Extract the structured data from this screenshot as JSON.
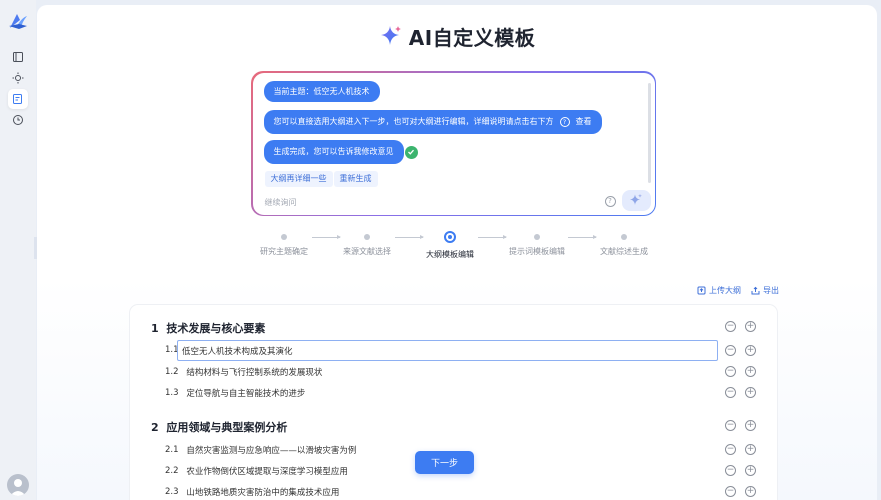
{
  "page": {
    "title": "AI自定义模板"
  },
  "chat": {
    "messages": [
      "当前主题：低空无人机技术",
      "您可以直接选用大纲进入下一步，也可对大纲进行编辑，详细说明请点击右下方",
      "生成完成，您可以告诉我修改意见"
    ],
    "help_badge": "?",
    "view_link": "查看",
    "chips": [
      "大纲再详细一些",
      "重新生成"
    ],
    "input_placeholder": "继续询问",
    "input_help": "?"
  },
  "steps": [
    {
      "label": "研究主题确定",
      "current": false
    },
    {
      "label": "来源文献选择",
      "current": false
    },
    {
      "label": "大纲模板编辑",
      "current": true
    },
    {
      "label": "提示词模板编辑",
      "current": false
    },
    {
      "label": "文献综述生成",
      "current": false
    }
  ],
  "actions": {
    "upload": "上传大纲",
    "export": "导出"
  },
  "outline": {
    "sections": [
      {
        "number": "1",
        "title": "技术发展与核心要素",
        "items": [
          {
            "number": "1.1",
            "text": "低空无人机技术构成及其演化"
          },
          {
            "number": "1.2",
            "text": "结构材料与飞行控制系统的发展现状"
          },
          {
            "number": "1.3",
            "text": "定位导航与自主智能技术的进步"
          }
        ]
      },
      {
        "number": "2",
        "title": "应用领域与典型案例分析",
        "items": [
          {
            "number": "2.1",
            "text": "自然灾害监测与应急响应——以滑坡灾害为例"
          },
          {
            "number": "2.2",
            "text": "农业作物倒伏区域提取与深度学习模型应用"
          },
          {
            "number": "2.3",
            "text": "山地铁路地质灾害防治中的集成技术应用"
          }
        ]
      }
    ],
    "minus": "−",
    "plus": "+"
  },
  "next_button": "下一步",
  "colors": {
    "primary": "#3d7cf2",
    "success": "#3cb46e"
  }
}
